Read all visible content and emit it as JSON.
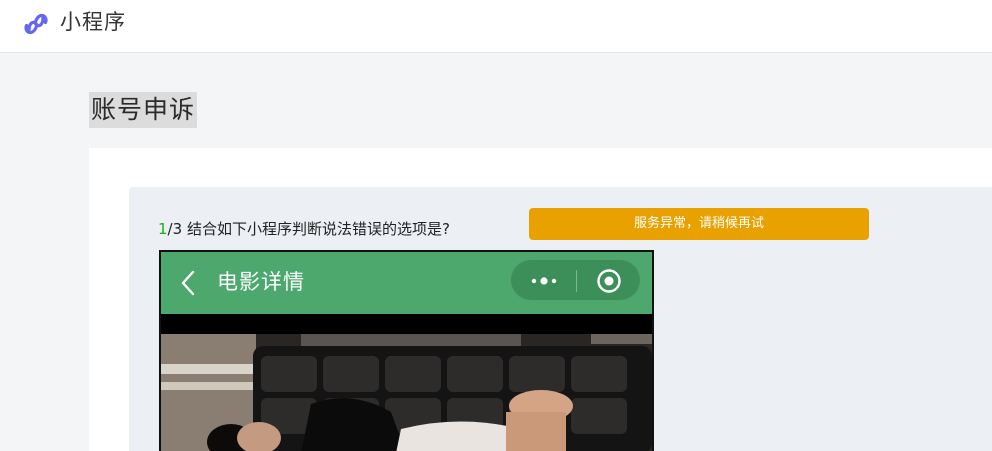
{
  "header": {
    "app_name": "小程序",
    "logo_icon": "mini-program-logo-icon"
  },
  "page": {
    "title": "账号申诉"
  },
  "question": {
    "current": "1",
    "total_suffix": "/3",
    "text": "结合如下小程序判断说法错误的选项是?"
  },
  "toast": {
    "message": "服务异常，请稍候再试",
    "color": "#e9a100"
  },
  "phone_preview": {
    "title": "电影详情",
    "back_icon": "chevron-left-icon",
    "more_icon": "more-dots-icon",
    "close_icon": "target-close-icon",
    "nav_color": "#4ca86d",
    "content_image": "video-frame-image"
  },
  "colors": {
    "accent_green": "#1aad19",
    "background": "#f4f5f7",
    "panel": "#eceff4"
  }
}
